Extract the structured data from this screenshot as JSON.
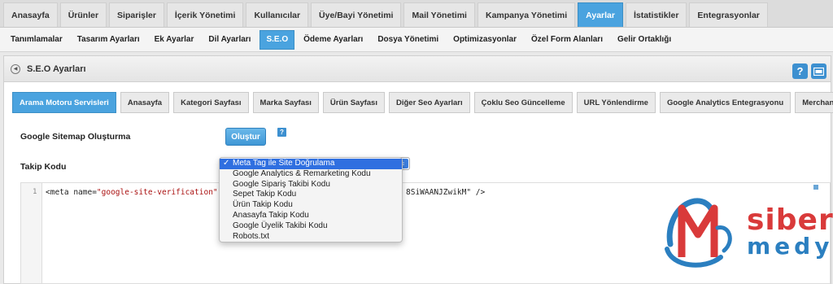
{
  "topnav": {
    "tabs": [
      {
        "label": "Anasayfa",
        "active": false
      },
      {
        "label": "Ürünler",
        "active": false
      },
      {
        "label": "Siparişler",
        "active": false
      },
      {
        "label": "İçerik Yönetimi",
        "active": false
      },
      {
        "label": "Kullanıcılar",
        "active": false
      },
      {
        "label": "Üye/Bayi Yönetimi",
        "active": false
      },
      {
        "label": "Mail Yönetimi",
        "active": false
      },
      {
        "label": "Kampanya Yönetimi",
        "active": false
      },
      {
        "label": "Ayarlar",
        "active": true
      },
      {
        "label": "İstatistikler",
        "active": false
      },
      {
        "label": "Entegrasyonlar",
        "active": false
      }
    ]
  },
  "subnav": {
    "items": [
      {
        "label": "Tanımlamalar",
        "active": false
      },
      {
        "label": "Tasarım Ayarları",
        "active": false
      },
      {
        "label": "Ek Ayarlar",
        "active": false
      },
      {
        "label": "Dil Ayarları",
        "active": false
      },
      {
        "label": "S.E.O",
        "active": true
      },
      {
        "label": "Ödeme Ayarları",
        "active": false
      },
      {
        "label": "Dosya Yönetimi",
        "active": false
      },
      {
        "label": "Optimizasyonlar",
        "active": false
      },
      {
        "label": "Özel Form Alanları",
        "active": false
      },
      {
        "label": "Gelir Ortaklığı",
        "active": false
      }
    ]
  },
  "panel": {
    "title": "S.E.O Ayarları",
    "help_label": "?",
    "tabs": [
      {
        "label": "Arama Motoru Servisleri",
        "active": true
      },
      {
        "label": "Anasayfa",
        "active": false
      },
      {
        "label": "Kategori Sayfası",
        "active": false
      },
      {
        "label": "Marka Sayfası",
        "active": false
      },
      {
        "label": "Ürün Sayfası",
        "active": false
      },
      {
        "label": "Diğer Seo Ayarları",
        "active": false
      },
      {
        "label": "Çoklu Seo Güncelleme",
        "active": false
      },
      {
        "label": "URL Yönlendirme",
        "active": false
      },
      {
        "label": "Google Analytics Entegrasyonu",
        "active": false
      },
      {
        "label": "Merchant Anket",
        "active": false
      }
    ]
  },
  "sitemap": {
    "label": "Google Sitemap Oluşturma",
    "button_label": "Oluştur",
    "help_label": "?"
  },
  "tracking": {
    "label": "Takip Kodu",
    "selected": "Meta Tag ile Site Doğrulama",
    "options": [
      "Meta Tag ile Site Doğrulama",
      "Google Analytics & Remarketing Kodu",
      "Google Sipariş Takibi Kodu",
      "Sepet Takip Kodu",
      "Ürün Takip Kodu",
      "Anasayfa Takip Kodu",
      "Google Üyelik Takibi Kodu",
      "Robots.txt"
    ]
  },
  "code_editor": {
    "line_number": "1",
    "code_start": "<meta name=",
    "code_string": "\"google-site-verification\"",
    "code_string_tail": "8SiWAANJZwikM\"",
    "code_end": " />"
  },
  "logo": {
    "line1": "siber",
    "line2": "medya"
  },
  "colors": {
    "accent": "#4aa3df",
    "logo_red": "#d93a3a",
    "logo_blue": "#2b7fc0"
  }
}
